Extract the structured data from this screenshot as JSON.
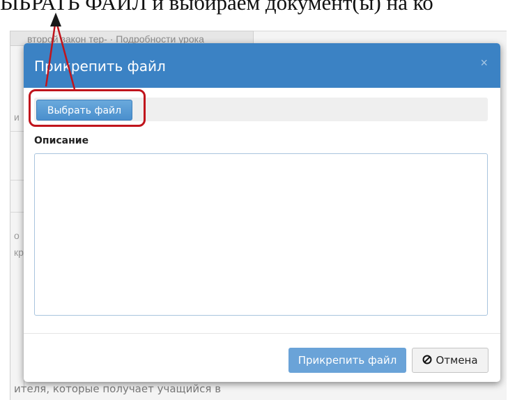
{
  "caption": {
    "text": "ЫБРАТЬ ФАЙЛ и выбираем документ(ы) на ко"
  },
  "background": {
    "tab_text": "второй закон тер-  ·  Подробности урока",
    "side_chars": [
      "и",
      "о",
      "кр"
    ],
    "bottom_text": "ителя, которые получает учащийся в"
  },
  "dialog": {
    "title": "Прикрепить файл",
    "close_symbol": "×",
    "choose_file_label": "Выбрать файл",
    "description_label": "Описание",
    "description_value": "",
    "attach_button_label": "Прикрепить файл",
    "cancel_button_label": "Отмена"
  },
  "colors": {
    "header": "#3b82c4",
    "primary_button": "#4a8fcd",
    "highlight": "#c0141c"
  },
  "icons": {
    "cancel": "ban-icon",
    "resize": "resize-grip-icon",
    "close": "close-icon"
  }
}
